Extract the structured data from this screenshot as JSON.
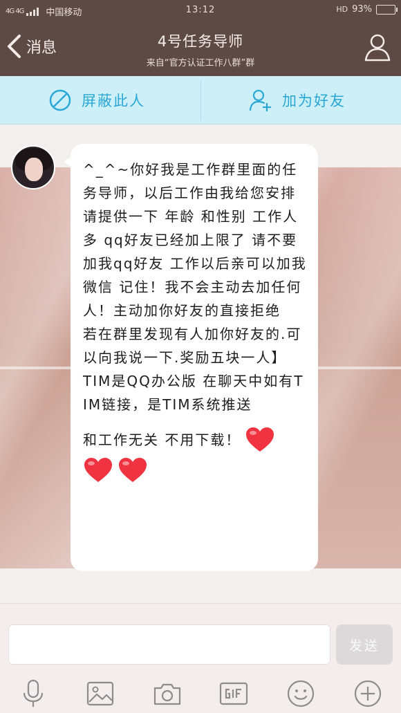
{
  "status_bar": {
    "network": "4G 4G",
    "carrier": "中国移动",
    "time": "13:12",
    "hd": "HD",
    "battery_percent": "93%",
    "battery_level": 0.93
  },
  "header": {
    "back_label": "消息",
    "title": "4号任务导师",
    "subtitle": "来自“官方认证工作八群”群"
  },
  "actions": {
    "block_label": "屏蔽此人",
    "add_friend_label": "加为好友"
  },
  "message": {
    "para1": "^_^~你好我是工作群里面的任务导师，以后工作由我给您安排 请提供一下 年龄 和性别 工作人多 qq好友已经加上限了 请不要加我qq好友 工作以后亲可以加我微信 记住！我不会主动去加任何人！主动加你好友的直接拒绝",
    "para2": "若在群里发现有人加你好友的.可以向我说一下.奖励五块一人】",
    "para3": "TIM是QQ办公版 在聊天中如有TIM链接，是TIM系统推送",
    "para4": "和工作无关 不用下载！"
  },
  "input": {
    "value": "",
    "send_label": "发送"
  },
  "colors": {
    "header_bg": "#5d4a44",
    "action_bar_bg": "#cdeff8",
    "action_accent": "#2aa7d5",
    "heart_red": "#ef3340"
  },
  "icons": [
    "back-chevron-icon",
    "profile-icon",
    "block-icon",
    "add-friend-icon",
    "heart-icon",
    "microphone-icon",
    "image-icon",
    "camera-icon",
    "gif-icon",
    "emoji-icon",
    "plus-icon"
  ]
}
